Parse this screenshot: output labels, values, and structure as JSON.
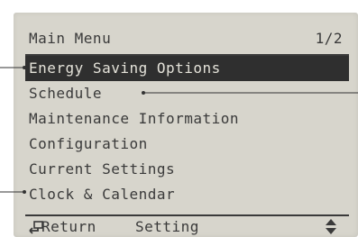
{
  "header": {
    "title": "Main Menu",
    "page_indicator": "1/2"
  },
  "menu": {
    "items": [
      {
        "label": "Energy Saving Options",
        "selected": true
      },
      {
        "label": "Schedule",
        "selected": false
      },
      {
        "label": "Maintenance Information",
        "selected": false
      },
      {
        "label": "Configuration",
        "selected": false
      },
      {
        "label": "Current Settings",
        "selected": false
      },
      {
        "label": "Clock & Calendar",
        "selected": false
      }
    ]
  },
  "footer": {
    "return_label": "Return",
    "setting_label": "Setting",
    "return_icon": "return-arrow-icon",
    "updown_icon": "up-down-arrows-icon"
  },
  "colors": {
    "lcd_background": "#d7d5cc",
    "lcd_text": "#3a3a3a",
    "highlight_background": "#2f2f2f",
    "highlight_text": "#e4e2d9"
  }
}
